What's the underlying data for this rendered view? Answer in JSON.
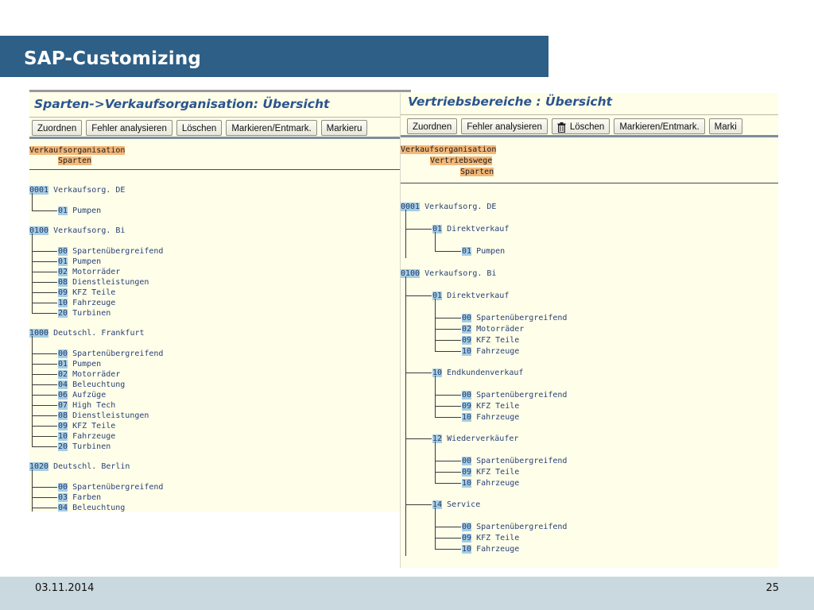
{
  "slide": {
    "title": "SAP-Customizing",
    "date": "03.11.2014",
    "page_number": "25"
  },
  "left_window": {
    "title": "Sparten->Verkaufsorganisation: Übersicht",
    "toolbar": [
      "Zuordnen",
      "Fehler analysieren",
      "Löschen",
      "Markieren/Entmark.",
      "Markieru"
    ],
    "headers": [
      "Verkaufsorganisation",
      "Sparten"
    ],
    "tree": [
      {
        "key": "0001",
        "label": "Verkaufsorg. DE",
        "children": [
          {
            "key": "01",
            "label": "Pumpen"
          }
        ]
      },
      {
        "key": "0100",
        "label": "Verkaufsorg. Bi",
        "children": [
          {
            "key": "00",
            "label": "Spartenübergreifend"
          },
          {
            "key": "01",
            "label": "Pumpen"
          },
          {
            "key": "02",
            "label": "Motorräder"
          },
          {
            "key": "08",
            "label": "Dienstleistungen"
          },
          {
            "key": "09",
            "label": "KFZ Teile"
          },
          {
            "key": "10",
            "label": "Fahrzeuge"
          },
          {
            "key": "20",
            "label": "Turbinen"
          }
        ]
      },
      {
        "key": "1000",
        "label": "Deutschl. Frankfurt",
        "children": [
          {
            "key": "00",
            "label": "Spartenübergreifend"
          },
          {
            "key": "01",
            "label": "Pumpen"
          },
          {
            "key": "02",
            "label": "Motorräder"
          },
          {
            "key": "04",
            "label": "Beleuchtung"
          },
          {
            "key": "06",
            "label": "Aufzüge"
          },
          {
            "key": "07",
            "label": "High Tech"
          },
          {
            "key": "08",
            "label": "Dienstleistungen"
          },
          {
            "key": "09",
            "label": "KFZ Teile"
          },
          {
            "key": "10",
            "label": "Fahrzeuge"
          },
          {
            "key": "20",
            "label": "Turbinen"
          }
        ]
      },
      {
        "key": "1020",
        "label": "Deutschl. Berlin",
        "children": [
          {
            "key": "00",
            "label": "Spartenübergreifend"
          },
          {
            "key": "03",
            "label": "Farben"
          },
          {
            "key": "04",
            "label": "Beleuchtung"
          }
        ]
      }
    ]
  },
  "right_window": {
    "title": "Vertriebsbereiche : Übersicht",
    "toolbar": [
      "Zuordnen",
      "Fehler analysieren",
      "Löschen",
      "Markieren/Entmark.",
      "Marki"
    ],
    "headers": [
      "Verkaufsorganisation",
      "Vertriebswege",
      "Sparten"
    ],
    "tree": [
      {
        "key": "0001",
        "label": "Verkaufsorg. DE",
        "children": [
          {
            "key": "01",
            "label": "Direktverkauf",
            "children": [
              {
                "key": "01",
                "label": "Pumpen"
              }
            ]
          }
        ]
      },
      {
        "key": "0100",
        "label": "Verkaufsorg. Bi",
        "children": [
          {
            "key": "01",
            "label": "Direktverkauf",
            "children": [
              {
                "key": "00",
                "label": "Spartenübergreifend"
              },
              {
                "key": "02",
                "label": "Motorräder"
              },
              {
                "key": "09",
                "label": "KFZ Teile"
              },
              {
                "key": "10",
                "label": "Fahrzeuge"
              }
            ]
          },
          {
            "key": "10",
            "label": "Endkundenverkauf",
            "children": [
              {
                "key": "00",
                "label": "Spartenübergreifend"
              },
              {
                "key": "09",
                "label": "KFZ Teile"
              },
              {
                "key": "10",
                "label": "Fahrzeuge"
              }
            ]
          },
          {
            "key": "12",
            "label": "Wiederverkäufer",
            "children": [
              {
                "key": "00",
                "label": "Spartenübergreifend"
              },
              {
                "key": "09",
                "label": "KFZ Teile"
              },
              {
                "key": "10",
                "label": "Fahrzeuge"
              }
            ]
          },
          {
            "key": "14",
            "label": "Service",
            "children": [
              {
                "key": "00",
                "label": "Spartenübergreifend"
              },
              {
                "key": "09",
                "label": "KFZ Teile"
              },
              {
                "key": "10",
                "label": "Fahrzeuge"
              }
            ]
          }
        ]
      }
    ]
  }
}
